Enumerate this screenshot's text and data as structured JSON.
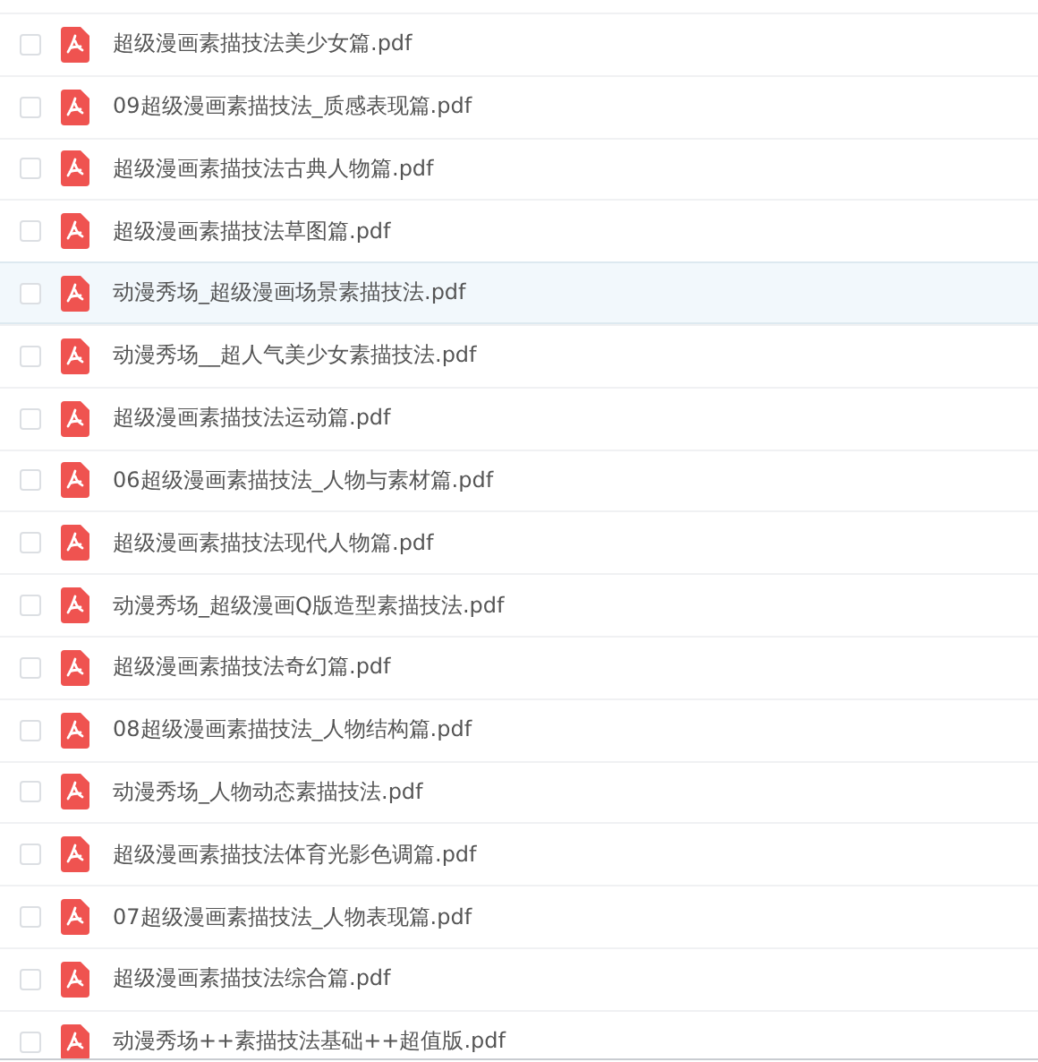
{
  "files": [
    {
      "name": "超级漫画素描技法美少女篇.pdf",
      "checked": false,
      "highlighted": false
    },
    {
      "name": "09超级漫画素描技法_质感表现篇.pdf",
      "checked": false,
      "highlighted": false
    },
    {
      "name": "超级漫画素描技法古典人物篇.pdf",
      "checked": false,
      "highlighted": false
    },
    {
      "name": "超级漫画素描技法草图篇.pdf",
      "checked": false,
      "highlighted": false
    },
    {
      "name": "动漫秀场_超级漫画场景素描技法.pdf",
      "checked": false,
      "highlighted": true
    },
    {
      "name": "动漫秀场__超人气美少女素描技法.pdf",
      "checked": false,
      "highlighted": false
    },
    {
      "name": "超级漫画素描技法运动篇.pdf",
      "checked": false,
      "highlighted": false
    },
    {
      "name": "06超级漫画素描技法_人物与素材篇.pdf",
      "checked": false,
      "highlighted": false
    },
    {
      "name": "超级漫画素描技法现代人物篇.pdf",
      "checked": false,
      "highlighted": false
    },
    {
      "name": "动漫秀场_超级漫画Q版造型素描技法.pdf",
      "checked": false,
      "highlighted": false
    },
    {
      "name": "超级漫画素描技法奇幻篇.pdf",
      "checked": false,
      "highlighted": false
    },
    {
      "name": "08超级漫画素描技法_人物结构篇.pdf",
      "checked": false,
      "highlighted": false
    },
    {
      "name": "动漫秀场_人物动态素描技法.pdf",
      "checked": false,
      "highlighted": false
    },
    {
      "name": "超级漫画素描技法体育光影色调篇.pdf",
      "checked": false,
      "highlighted": false
    },
    {
      "name": "07超级漫画素描技法_人物表现篇.pdf",
      "checked": false,
      "highlighted": false
    },
    {
      "name": "超级漫画素描技法综合篇.pdf",
      "checked": false,
      "highlighted": false
    },
    {
      "name": "动漫秀场++素描技法基础++超值版.pdf",
      "checked": false,
      "highlighted": false
    }
  ]
}
